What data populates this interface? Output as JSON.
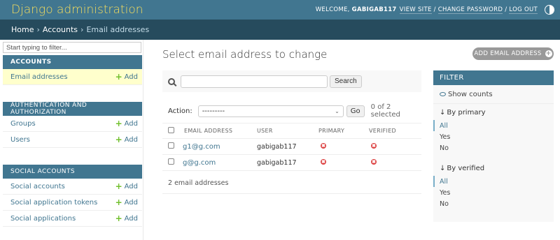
{
  "header": {
    "branding": "Django administration",
    "welcome_prefix": "WELCOME,",
    "username": "GABIGAB117",
    "view_site": "VIEW SITE",
    "change_password": "CHANGE PASSWORD",
    "log_out": "LOG OUT",
    "sep": "/"
  },
  "breadcrumbs": [
    "Home",
    "Accounts",
    "Email addresses"
  ],
  "breadcrumb_sep": "›",
  "sidebar": {
    "filter_placeholder": "Start typing to filter...",
    "add_label": "Add",
    "modules": [
      {
        "caption": "ACCOUNTS",
        "models": [
          "Email addresses"
        ]
      },
      {
        "caption": "AUTHENTICATION AND AUTHORIZATION",
        "models": [
          "Groups",
          "Users"
        ]
      },
      {
        "caption": "SOCIAL ACCOUNTS",
        "models": [
          "Social accounts",
          "Social application tokens",
          "Social applications"
        ]
      }
    ]
  },
  "main": {
    "title": "Select email address to change",
    "add_button": "ADD EMAIL ADDRESS",
    "search_button": "Search",
    "action_label": "Action:",
    "action_value": "---------",
    "go_button": "Go",
    "selected_count": "0 of 2 selected",
    "columns": [
      "EMAIL ADDRESS",
      "USER",
      "PRIMARY",
      "VERIFIED"
    ],
    "rows": [
      {
        "email": "g1@g.com",
        "user": "gabigab117",
        "primary": false,
        "verified": false
      },
      {
        "email": "g@g.com",
        "user": "gabigab117",
        "primary": false,
        "verified": false
      }
    ],
    "paginator": "2 email addresses"
  },
  "filter": {
    "title": "FILTER",
    "show_counts": "Show counts",
    "groups": [
      {
        "heading": "By primary",
        "options": [
          "All",
          "Yes",
          "No"
        ],
        "active": "All"
      },
      {
        "heading": "By verified",
        "options": [
          "All",
          "Yes",
          "No"
        ],
        "active": "All"
      }
    ]
  },
  "colors": {
    "header": "#417690",
    "breadcrumbs": "#264b5d",
    "branding": "#f5dd5d",
    "link": "#417690",
    "add_icon": "#70bf2b",
    "selected_row": "#ffffcc",
    "bool_no": "#dd4646"
  }
}
